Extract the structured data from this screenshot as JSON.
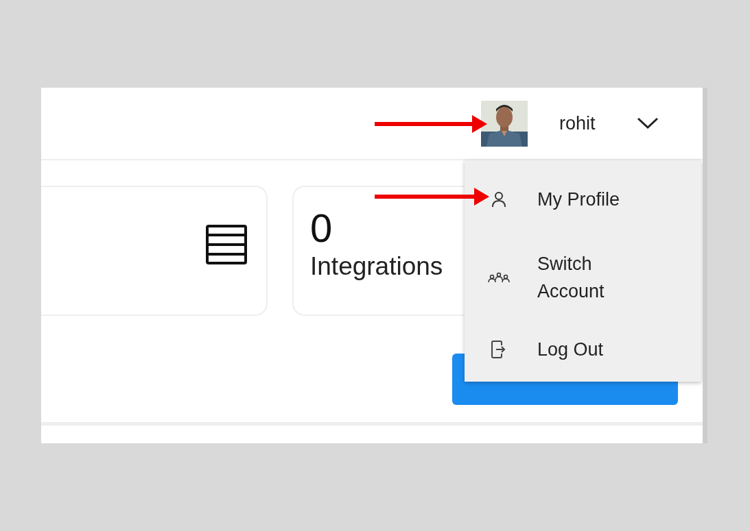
{
  "header": {
    "user_name": "rohit",
    "menu_expanded": true
  },
  "cards": [
    {
      "kind": "icon"
    },
    {
      "kind": "stat",
      "value": "0",
      "label": "Integrations"
    }
  ],
  "create_button": {
    "kind": "primary"
  },
  "user_menu": [
    {
      "kind": "profile",
      "label": "My Profile"
    },
    {
      "kind": "switch",
      "label": "Switch Account"
    },
    {
      "kind": "logout",
      "label": "Log Out"
    }
  ],
  "annotations": [
    {
      "kind": "arrow"
    },
    {
      "kind": "arrow"
    }
  ]
}
